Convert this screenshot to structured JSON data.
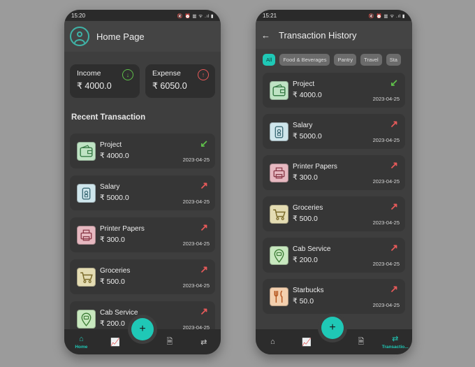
{
  "home": {
    "status_time": "15:20",
    "status_icons": "🔇 ⏰ ▥ ᯤ .ıl ▮",
    "title": "Home Page",
    "income": {
      "label": "Income",
      "value": "₹ 4000.0"
    },
    "expense": {
      "label": "Expense",
      "value": "₹ 6050.0"
    },
    "section_title": "Recent Transaction",
    "transactions": [
      {
        "title": "Project",
        "amount": "₹ 4000.0",
        "date": "2023-04-25",
        "arrow": "↙",
        "color": "#5fc04a",
        "icon": "wallet-icon",
        "icon_bg": "#bfe3c4"
      },
      {
        "title": "Salary",
        "amount": "₹ 5000.0",
        "date": "2023-04-25",
        "arrow": "↗",
        "color": "#e85a5a",
        "icon": "id-badge-icon",
        "icon_bg": "#cfe6ec"
      },
      {
        "title": "Printer Papers",
        "amount": "₹ 300.0",
        "date": "2023-04-25",
        "arrow": "↗",
        "color": "#e85a5a",
        "icon": "printer-icon",
        "icon_bg": "#e6b8c0"
      },
      {
        "title": "Groceries",
        "amount": "₹ 500.0",
        "date": "2023-04-25",
        "arrow": "↗",
        "color": "#e85a5a",
        "icon": "cart-icon",
        "icon_bg": "#e4dcb3"
      },
      {
        "title": "Cab Service",
        "amount": "₹ 200.0",
        "date": "2023-04-25",
        "arrow": "↗",
        "color": "#e85a5a",
        "icon": "cab-icon",
        "icon_bg": "#c8e8bf"
      }
    ],
    "nav": [
      {
        "label": "Home",
        "icon": "⌂"
      },
      {
        "label": "",
        "icon": "📈"
      },
      {
        "label": "",
        "icon": "🗎"
      },
      {
        "label": "",
        "icon": "⇄"
      }
    ],
    "fab": "+"
  },
  "history": {
    "status_time": "15:21",
    "status_icons": "🔇 ⏰ ▥ ᯤ .ıl ▮",
    "back": "←",
    "title": "Transaction History",
    "chips": [
      "All",
      "Food & Beverages",
      "Pantry",
      "Travel",
      "Sta"
    ],
    "transactions": [
      {
        "title": "Project",
        "amount": "₹ 4000.0",
        "date": "2023-04-25",
        "arrow": "↙",
        "color": "#5fc04a",
        "icon": "wallet-icon",
        "icon_bg": "#bfe3c4"
      },
      {
        "title": "Salary",
        "amount": "₹ 5000.0",
        "date": "2023-04-25",
        "arrow": "↗",
        "color": "#e85a5a",
        "icon": "id-badge-icon",
        "icon_bg": "#cfe6ec"
      },
      {
        "title": "Printer Papers",
        "amount": "₹ 300.0",
        "date": "2023-04-25",
        "arrow": "↗",
        "color": "#e85a5a",
        "icon": "printer-icon",
        "icon_bg": "#e6b8c0"
      },
      {
        "title": "Groceries",
        "amount": "₹ 500.0",
        "date": "2023-04-25",
        "arrow": "↗",
        "color": "#e85a5a",
        "icon": "cart-icon",
        "icon_bg": "#e4dcb3"
      },
      {
        "title": "Cab Service",
        "amount": "₹ 200.0",
        "date": "2023-04-25",
        "arrow": "↗",
        "color": "#e85a5a",
        "icon": "cab-icon",
        "icon_bg": "#c8e8bf"
      },
      {
        "title": "Starbucks",
        "amount": "₹ 50.0",
        "date": "2023-04-25",
        "arrow": "↗",
        "color": "#e85a5a",
        "icon": "fork-knife-icon",
        "icon_bg": "#f3cfae"
      }
    ],
    "nav": [
      {
        "label": "",
        "icon": "⌂"
      },
      {
        "label": "",
        "icon": "📈"
      },
      {
        "label": "",
        "icon": "🗎"
      },
      {
        "label": "Transactio...",
        "icon": "⇄"
      }
    ],
    "fab": "+"
  }
}
